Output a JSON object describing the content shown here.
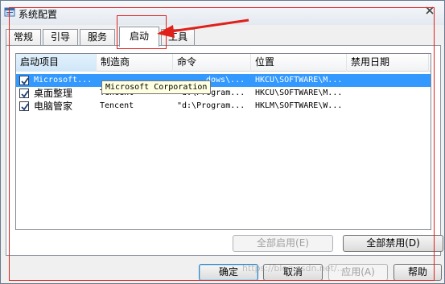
{
  "window": {
    "title": "系统配置",
    "title_icon": "msconfig-icon",
    "close_icon": "close-icon"
  },
  "tabs": [
    {
      "label": "常规",
      "active": false
    },
    {
      "label": "引导",
      "active": false
    },
    {
      "label": "服务",
      "active": false
    },
    {
      "label": "启动",
      "active": true
    },
    {
      "label": "工具",
      "active": false
    }
  ],
  "startup_list": {
    "columns": [
      "启动项目",
      "制造商",
      "命令",
      "位置",
      "禁用日期"
    ],
    "rows": [
      {
        "checked": true,
        "item": "Microsoft...",
        "manufacturer": "",
        "command": "dows\\...",
        "location": "HKCU\\SOFTWARE\\M...",
        "disabled_date": "",
        "selected": true
      },
      {
        "checked": true,
        "item": "桌面整理",
        "manufacturer": "Tencent",
        "command": "\"d:\\Program...",
        "location": "HKCU\\SOFTWARE\\M...",
        "disabled_date": "",
        "selected": false
      },
      {
        "checked": true,
        "item": "电脑管家",
        "manufacturer": "Tencent",
        "command": "\"d:\\Program...",
        "location": "HKLM\\SOFTWARE\\W...",
        "disabled_date": "",
        "selected": false
      }
    ],
    "tooltip": "Microsoft Corporation"
  },
  "panel_buttons": {
    "enable_all": "全部启用(E)",
    "disable_all": "全部禁用(D)"
  },
  "dialog_buttons": {
    "ok": "确定",
    "cancel": "取消",
    "apply": "应用(A)",
    "help": "帮助"
  },
  "annotation": {
    "color": "#e0201a"
  },
  "watermark": "https://blog.csdn.net/..."
}
